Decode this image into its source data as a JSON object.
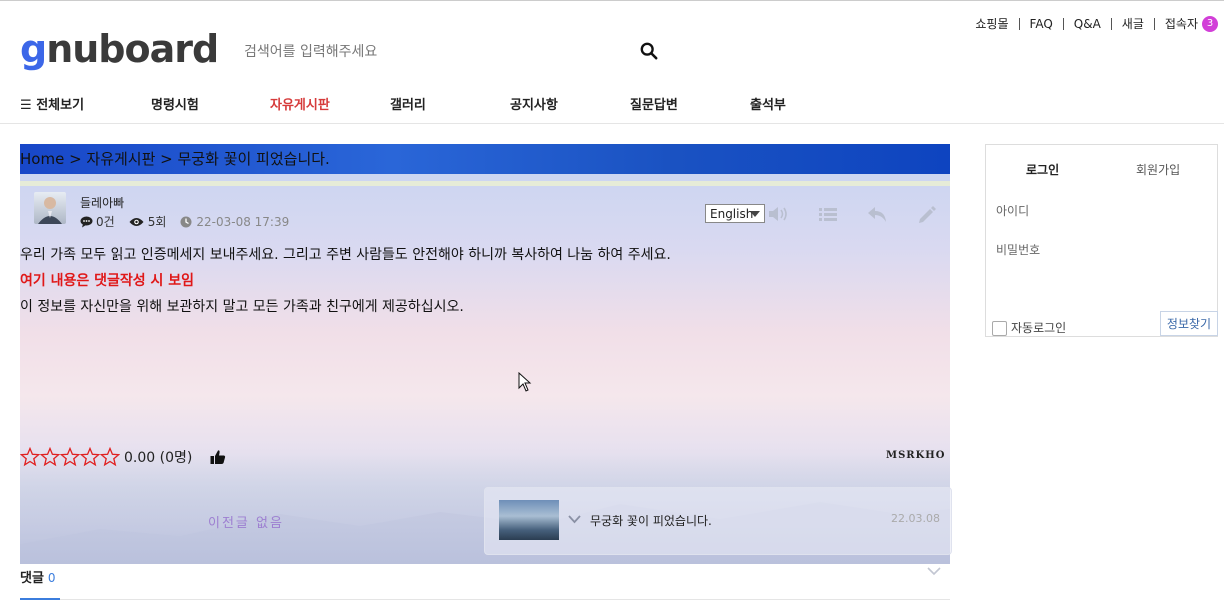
{
  "top_links": [
    "쇼핑몰",
    "FAQ",
    "Q&A",
    "새글",
    "접속자"
  ],
  "visitor_count": "3",
  "logo": {
    "g": "g",
    "rest": "nuboard"
  },
  "search": {
    "placeholder": "검색어를 입력해주세요"
  },
  "nav": {
    "all": "전체보기",
    "items": [
      "명령시험",
      "자유게시판",
      "갤러리",
      "공지사항",
      "질문답변",
      "출석부"
    ]
  },
  "breadcrumb": "Home > 자유게시판 > 무궁화 꽃이 피었습니다.",
  "post": {
    "author": "들레아빠",
    "comments": "0건",
    "views": "5회",
    "date": "22-03-08 17:39",
    "language": "English",
    "lines": [
      "우리 가족 모두 읽고 인증메세지 보내주세요. 그리고 주변 사람들도 안전해야 하니까 복사하여 나눔 하여 주세요.",
      "여기 내용은 댓글작성 시 보임",
      "이 정보를 자신만을 위해 보관하지 말고 모든 가족과 친구에게 제공하십시오."
    ],
    "rating": "0.00 (0명)",
    "rating_stars": 0,
    "signature": "MSRKHO"
  },
  "prev": "이전글 없음",
  "next": {
    "title": "무궁화 꽃이 피었습니다.",
    "date": "22.03.08"
  },
  "comments": {
    "label": "댓글",
    "count": "0"
  },
  "login": {
    "tab_login": "로그인",
    "tab_join": "회원가입",
    "id": "아이디",
    "password": "비밀번호",
    "auto": "자동로그인",
    "find": "정보찾기"
  },
  "colors": {
    "accent": "#3c67e8",
    "red": "#e01818",
    "link": "#3b7ddd",
    "nav_active": "#d63a3a"
  }
}
